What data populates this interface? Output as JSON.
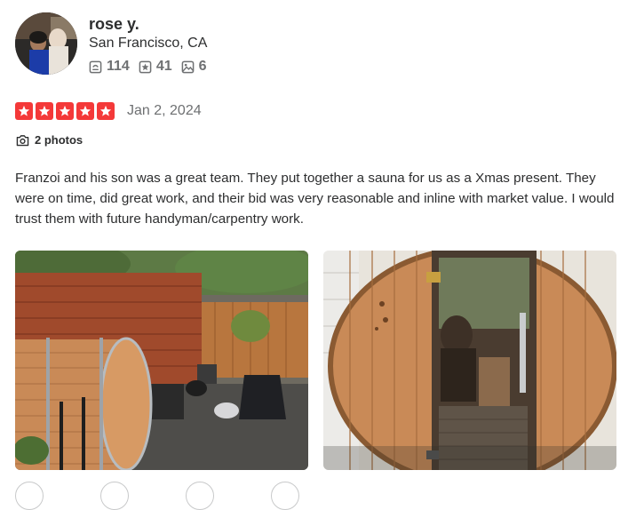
{
  "user": {
    "name": "rose y.",
    "location": "San Francisco, CA",
    "stats": {
      "reviews": "114",
      "elite": "41",
      "photos": "6"
    }
  },
  "review": {
    "rating": 5,
    "date": "Jan 2, 2024",
    "photos_label": "2 photos",
    "text": "Franzoi and his son was a great team. They put together a sauna for us as a Xmas present. They were on time, did great work, and their bid was very reasonable and inline with market value. I would trust them with future handyman/carpentry work."
  },
  "colors": {
    "star_red": "#f43939",
    "text_dark": "#2d2e2f",
    "text_gray": "#6e7072"
  }
}
